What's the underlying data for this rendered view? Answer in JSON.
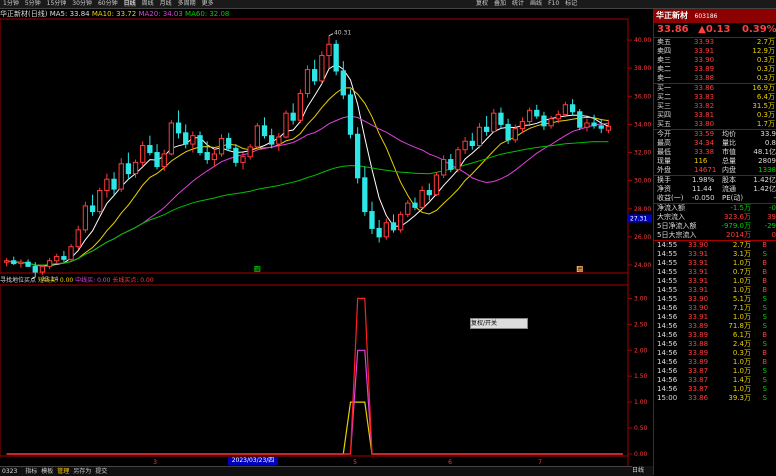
{
  "toolbar": {
    "items": [
      "1分钟",
      "5分钟",
      "15分钟",
      "30分钟",
      "60分钟",
      "日线",
      "周线",
      "月线",
      "多周期",
      "更多"
    ],
    "right_items": [
      "复权",
      "叠加",
      "统计",
      "画线",
      "F10",
      "标记"
    ]
  },
  "title": {
    "name": "华正新材(日线)",
    "ma5": "MA5: 33.84",
    "ma10": "MA10: 33.72",
    "ma20": "MA20: 34.03",
    "ma60": "MA60: 32.08"
  },
  "indicator": {
    "name": "寻找地位买点",
    "l1": "短线买: 0.00",
    "l2": "中线买: 0.00",
    "l3": "长线买点: 0.00"
  },
  "popup": "复权/开关",
  "bottom": {
    "date_left": "0323",
    "date_mid": "2023/03/23/四",
    "tabs": [
      "指标",
      "模板",
      "管理",
      "另存为",
      "提交"
    ],
    "right": "日线"
  },
  "panel": {
    "title": "华正新材",
    "code": "603186",
    "price": "33.86",
    "change": "▲0.13",
    "pct": "0.39%",
    "asks": [
      {
        "label": "卖五",
        "price": "33.93",
        "vol": "2.7万"
      },
      {
        "label": "卖四",
        "price": "33.91",
        "vol": "12.9万"
      },
      {
        "label": "卖三",
        "price": "33.90",
        "vol": "0.3万"
      },
      {
        "label": "卖二",
        "price": "33.89",
        "vol": "0.3万"
      },
      {
        "label": "卖一",
        "price": "33.88",
        "vol": "0.3万"
      }
    ],
    "bids": [
      {
        "label": "买一",
        "price": "33.86",
        "vol": "16.9万"
      },
      {
        "label": "买二",
        "price": "33.83",
        "vol": "6.4万"
      },
      {
        "label": "买三",
        "price": "33.82",
        "vol": "31.5万"
      },
      {
        "label": "买四",
        "price": "33.81",
        "vol": "0.3万"
      },
      {
        "label": "买五",
        "price": "33.80",
        "vol": "1.7万"
      }
    ],
    "stats": [
      {
        "a": "今开",
        "b": "33.59",
        "c": "均价",
        "d": "33.9"
      },
      {
        "a": "最高",
        "b": "34.34",
        "c": "量比",
        "d": "0.8"
      },
      {
        "a": "最低",
        "b": "33.38",
        "c": "市值",
        "d": "48.1亿"
      },
      {
        "a": "现量",
        "b": "116",
        "c": "总量",
        "d": "2809"
      },
      {
        "a": "外盘",
        "b": "14671",
        "c": "内盘",
        "d": "1338"
      }
    ],
    "stats2": [
      {
        "a": "换手",
        "b": "1.98%",
        "c": "股本",
        "d": "1.42亿"
      },
      {
        "a": "净资",
        "b": "11.44",
        "c": "流通",
        "d": "1.42亿"
      },
      {
        "a": "收益(一)",
        "b": "-0.050",
        "c": "PE(动)",
        "d": "-"
      }
    ],
    "flows": [
      {
        "label": "净流入额",
        "v1": "-1.5万",
        "v2": "-0"
      },
      {
        "label": "大宗流入",
        "v1": "323.6万",
        "v2": "39"
      },
      {
        "label": "5日净流入额",
        "v1": "-979.0万",
        "v2": "-29"
      },
      {
        "label": "5日大宗流入",
        "v1": "2014万",
        "v2": "0"
      }
    ],
    "ticks": [
      {
        "t": "14:55",
        "p": "33.90",
        "v": "2.7万",
        "s": "B"
      },
      {
        "t": "14:55",
        "p": "33.91",
        "v": "3.1万",
        "s": "S"
      },
      {
        "t": "14:55",
        "p": "33.91",
        "v": "1.0万",
        "s": "B"
      },
      {
        "t": "14:55",
        "p": "33.91",
        "v": "0.7万",
        "s": "B"
      },
      {
        "t": "14:55",
        "p": "33.91",
        "v": "1.0万",
        "s": "B"
      },
      {
        "t": "14:55",
        "p": "33.91",
        "v": "1.0万",
        "s": "B"
      },
      {
        "t": "14:55",
        "p": "33.90",
        "v": "5.1万",
        "s": "S"
      },
      {
        "t": "14:56",
        "p": "33.90",
        "v": "7.1万",
        "s": "S"
      },
      {
        "t": "14:56",
        "p": "33.91",
        "v": "1.0万",
        "s": "S"
      },
      {
        "t": "14:56",
        "p": "33.89",
        "v": "71.8万",
        "s": "S"
      },
      {
        "t": "14:56",
        "p": "33.89",
        "v": "6.1万",
        "s": "B"
      },
      {
        "t": "14:56",
        "p": "33.88",
        "v": "2.4万",
        "s": "S"
      },
      {
        "t": "14:56",
        "p": "33.89",
        "v": "0.3万",
        "s": "B"
      },
      {
        "t": "14:56",
        "p": "33.89",
        "v": "1.0万",
        "s": "B"
      },
      {
        "t": "14:56",
        "p": "33.87",
        "v": "1.0万",
        "s": "S"
      },
      {
        "t": "14:56",
        "p": "33.87",
        "v": "1.4万",
        "s": "S"
      },
      {
        "t": "14:56",
        "p": "33.87",
        "v": "1.0万",
        "s": "S"
      },
      {
        "t": "15:00",
        "p": "33.86",
        "v": "39.3万",
        "s": "S"
      }
    ]
  },
  "chart_data": [
    {
      "type": "candlestick",
      "title": "华正新材(日线)",
      "ylim": [
        23.5,
        41.5
      ],
      "y_ticks": [
        "40.00",
        "38.00",
        "36.00",
        "34.00",
        "32.00",
        "30.00",
        "28.00",
        "26.00",
        "24.00"
      ],
      "current_price_label": "27.31",
      "annotations": [
        {
          "label": "40.31"
        },
        {
          "label": "23.14"
        }
      ],
      "ohlc": [
        [
          24.2,
          24.5,
          23.9,
          24.3
        ],
        [
          24.3,
          24.6,
          24.0,
          24.1
        ],
        [
          24.1,
          24.4,
          23.8,
          24.2
        ],
        [
          24.2,
          24.4,
          23.9,
          23.9
        ],
        [
          23.9,
          24.2,
          23.14,
          23.5
        ],
        [
          23.5,
          24.0,
          23.3,
          23.9
        ],
        [
          23.9,
          24.5,
          23.7,
          24.3
        ],
        [
          24.3,
          24.8,
          24.1,
          24.6
        ],
        [
          24.6,
          25.0,
          24.2,
          24.4
        ],
        [
          24.4,
          25.5,
          24.3,
          25.3
        ],
        [
          25.3,
          26.8,
          25.1,
          26.5
        ],
        [
          26.5,
          28.5,
          26.3,
          28.2
        ],
        [
          28.2,
          29.0,
          27.5,
          27.8
        ],
        [
          27.8,
          29.5,
          27.6,
          29.3
        ],
        [
          29.3,
          30.5,
          28.8,
          30.1
        ],
        [
          30.1,
          30.6,
          29.0,
          29.4
        ],
        [
          29.4,
          31.6,
          29.2,
          31.2
        ],
        [
          31.2,
          32.0,
          30.1,
          30.5
        ],
        [
          30.5,
          31.5,
          30.2,
          31.3
        ],
        [
          31.3,
          32.8,
          31.0,
          32.5
        ],
        [
          32.5,
          33.2,
          31.8,
          32.0
        ],
        [
          32.0,
          32.6,
          30.8,
          31.0
        ],
        [
          31.0,
          32.2,
          30.7,
          31.9
        ],
        [
          31.9,
          34.3,
          31.8,
          34.1
        ],
        [
          34.1,
          35.0,
          33.0,
          33.4
        ],
        [
          33.4,
          34.0,
          32.3,
          32.6
        ],
        [
          32.6,
          33.5,
          32.0,
          33.2
        ],
        [
          33.2,
          33.5,
          31.8,
          32.0
        ],
        [
          32.0,
          32.8,
          31.2,
          31.5
        ],
        [
          31.5,
          32.3,
          31.0,
          31.9
        ],
        [
          31.9,
          33.3,
          31.7,
          33.0
        ],
        [
          33.0,
          33.4,
          32.1,
          32.3
        ],
        [
          32.3,
          32.6,
          31.0,
          31.3
        ],
        [
          31.3,
          32.0,
          30.8,
          31.7
        ],
        [
          31.7,
          32.6,
          31.5,
          32.4
        ],
        [
          32.4,
          34.1,
          32.2,
          33.9
        ],
        [
          33.9,
          34.5,
          33.0,
          33.2
        ],
        [
          33.2,
          33.7,
          32.3,
          32.6
        ],
        [
          32.6,
          33.4,
          32.1,
          33.1
        ],
        [
          33.1,
          35.0,
          33.0,
          34.8
        ],
        [
          34.8,
          35.5,
          34.0,
          34.3
        ],
        [
          34.3,
          36.5,
          34.1,
          36.2
        ],
        [
          36.2,
          38.2,
          35.9,
          37.9
        ],
        [
          37.9,
          38.6,
          36.8,
          37.1
        ],
        [
          37.1,
          39.2,
          36.9,
          38.9
        ],
        [
          38.9,
          40.31,
          38.0,
          39.7
        ],
        [
          39.7,
          40.0,
          37.5,
          37.8
        ],
        [
          37.8,
          38.5,
          35.8,
          36.1
        ],
        [
          36.1,
          36.5,
          33.0,
          33.3
        ],
        [
          33.3,
          33.8,
          29.8,
          30.2
        ],
        [
          30.2,
          31.0,
          27.5,
          27.8
        ],
        [
          27.8,
          28.5,
          26.2,
          26.6
        ],
        [
          26.6,
          27.2,
          25.6,
          26.0
        ],
        [
          26.0,
          27.3,
          25.8,
          27.0
        ],
        [
          27.0,
          27.6,
          26.3,
          26.5
        ],
        [
          26.5,
          27.8,
          26.3,
          27.6
        ],
        [
          27.6,
          28.6,
          27.4,
          28.4
        ],
        [
          28.4,
          28.8,
          27.9,
          28.1
        ],
        [
          28.1,
          29.6,
          28.0,
          29.3
        ],
        [
          29.3,
          29.8,
          28.6,
          29.0
        ],
        [
          29.0,
          30.6,
          28.9,
          30.4
        ],
        [
          30.4,
          31.8,
          30.2,
          31.5
        ],
        [
          31.5,
          31.9,
          30.6,
          30.8
        ],
        [
          30.8,
          32.4,
          30.6,
          32.2
        ],
        [
          32.2,
          33.1,
          31.9,
          32.8
        ],
        [
          32.8,
          33.4,
          32.2,
          32.5
        ],
        [
          32.5,
          34.1,
          32.3,
          33.8
        ],
        [
          33.8,
          34.6,
          33.2,
          33.5
        ],
        [
          33.5,
          35.1,
          33.4,
          34.8
        ],
        [
          34.8,
          35.2,
          33.7,
          34.0
        ],
        [
          34.0,
          34.4,
          32.6,
          32.9
        ],
        [
          32.9,
          34.0,
          32.7,
          33.7
        ],
        [
          33.7,
          34.5,
          33.4,
          34.2
        ],
        [
          34.2,
          35.2,
          34.0,
          35.0
        ],
        [
          35.0,
          35.4,
          34.4,
          34.6
        ],
        [
          34.6,
          34.9,
          33.6,
          33.9
        ],
        [
          33.9,
          34.6,
          33.7,
          34.4
        ],
        [
          34.4,
          35.0,
          34.1,
          34.7
        ],
        [
          34.7,
          35.6,
          34.5,
          35.4
        ],
        [
          35.4,
          35.8,
          34.6,
          34.9
        ],
        [
          34.9,
          35.1,
          33.6,
          33.8
        ],
        [
          33.8,
          34.4,
          33.5,
          34.1
        ],
        [
          34.1,
          34.7,
          33.7,
          33.9
        ],
        [
          33.9,
          34.4,
          33.38,
          33.73
        ],
        [
          33.59,
          34.34,
          33.38,
          33.86
        ]
      ],
      "ma_series": [
        {
          "name": "MA5",
          "color": "#ffffff"
        },
        {
          "name": "MA10",
          "color": "#e8d000"
        },
        {
          "name": "MA20",
          "color": "#e040e0"
        },
        {
          "name": "MA60",
          "color": "#00c000"
        }
      ],
      "markers": [
        {
          "index": 35,
          "label": "减",
          "color": "#00b000"
        },
        {
          "index": 80,
          "label": "增",
          "color": "#ffb060"
        }
      ]
    },
    {
      "type": "line",
      "title": "寻找地位买点",
      "ylim": [
        0,
        3.2
      ],
      "y_ticks": [
        "3.00",
        "2.50",
        "2.00",
        "1.50",
        "1.00",
        "0.50",
        "0.00"
      ],
      "series": [
        {
          "name": "短线买",
          "color": "#e8d000",
          "points": [
            [
              0,
              0
            ],
            [
              47,
              0
            ],
            [
              48,
              1
            ],
            [
              50,
              1
            ],
            [
              51,
              0
            ],
            [
              86,
              0
            ]
          ]
        },
        {
          "name": "中线买",
          "color": "#e040e0",
          "points": [
            [
              0,
              0
            ],
            [
              48,
              0
            ],
            [
              49,
              2
            ],
            [
              50,
              2
            ],
            [
              51,
              0
            ],
            [
              86,
              0
            ]
          ]
        },
        {
          "name": "长线买点",
          "color": "#ff2020",
          "points": [
            [
              0,
              0
            ],
            [
              48,
              0
            ],
            [
              49,
              3
            ],
            [
              50,
              3
            ],
            [
              51,
              0
            ],
            [
              86,
              0
            ]
          ]
        }
      ]
    }
  ],
  "x_labels": [
    "3",
    "4",
    "5",
    "6",
    "7"
  ]
}
